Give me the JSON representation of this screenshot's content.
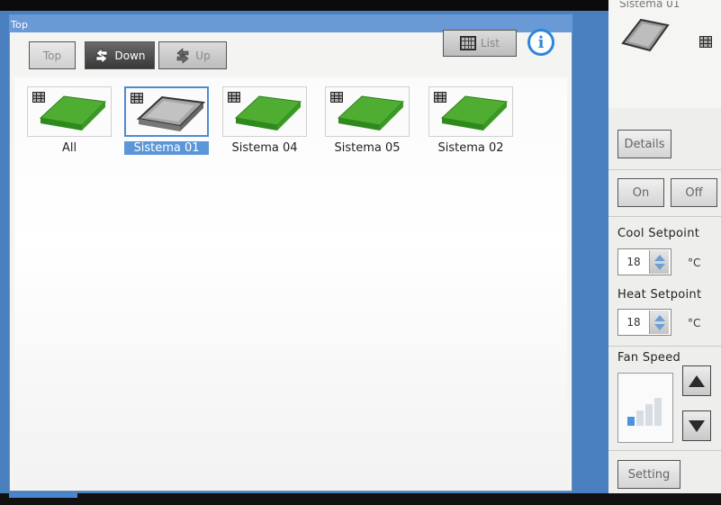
{
  "main": {
    "title": "Top",
    "toolbar": {
      "top_label": "Top",
      "down_label": "Down",
      "up_label": "Up",
      "list_label": "List"
    },
    "tiles": [
      {
        "label": "All",
        "color": "#4fae32",
        "selected": false
      },
      {
        "label": "Sistema 01",
        "color": "#9a9a9a",
        "selected": true
      },
      {
        "label": "Sistema 04",
        "color": "#4fae32",
        "selected": false
      },
      {
        "label": "Sistema 05",
        "color": "#4fae32",
        "selected": false
      },
      {
        "label": "Sistema 02",
        "color": "#4fae32",
        "selected": false
      }
    ]
  },
  "sidebar": {
    "header_label": "Sistema 01",
    "details_label": "Details",
    "on_label": "On",
    "off_label": "Off",
    "cool_setpoint_label": "Cool Setpoint",
    "cool_setpoint_value": "18",
    "heat_setpoint_label": "Heat Setpoint",
    "heat_setpoint_value": "18",
    "unit": "°C",
    "fan_speed_label": "Fan Speed",
    "fan_speed_level": 0.25,
    "setting_label": "Setting"
  },
  "colors": {
    "accent": "#4a86d0",
    "selected": "#5a96d8",
    "device_on": "#4fae32",
    "device_off": "#9a9a9a"
  },
  "icons": [
    "down-arrow-icon",
    "up-arrow-icon",
    "list-grid-icon",
    "info-icon",
    "fan-level-icon"
  ]
}
